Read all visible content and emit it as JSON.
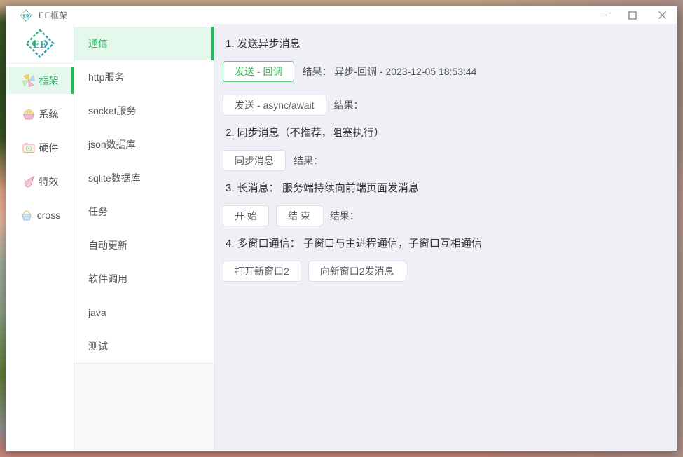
{
  "window": {
    "title": "EE框架",
    "controls": {
      "minimize": "minimize",
      "maximize": "maximize",
      "close": "close"
    }
  },
  "colors": {
    "accent_green": "#21b85f",
    "accent_bar": "#1fbb5b",
    "active_bg": "#e4f8ec",
    "content_bg": "#eef0f5",
    "button_border": "#dadde3",
    "success_border": "#5fc878",
    "success_text": "#3cb45a"
  },
  "sidebar_primary": {
    "logo_text": "EE",
    "items": [
      {
        "label": "框架",
        "icon": "pinwheel-icon",
        "active": true
      },
      {
        "label": "系统",
        "icon": "basket-icon",
        "active": false
      },
      {
        "label": "硬件",
        "icon": "camera-icon",
        "active": false
      },
      {
        "label": "特效",
        "icon": "comet-icon",
        "active": false
      },
      {
        "label": "cross",
        "icon": "bin-icon",
        "active": false
      }
    ]
  },
  "sidebar_secondary": {
    "items": [
      {
        "label": "通信",
        "active": true
      },
      {
        "label": "http服务",
        "active": false
      },
      {
        "label": "socket服务",
        "active": false
      },
      {
        "label": "json数据库",
        "active": false
      },
      {
        "label": "sqlite数据库",
        "active": false
      },
      {
        "label": "任务",
        "active": false
      },
      {
        "label": "自动更新",
        "active": false
      },
      {
        "label": "软件调用",
        "active": false
      },
      {
        "label": "java",
        "active": false
      },
      {
        "label": "测试",
        "active": false
      }
    ]
  },
  "main": {
    "sections": [
      {
        "heading": "1. 发送异步消息",
        "rows": [
          {
            "buttons": [
              {
                "label": "发送 - 回调",
                "variant": "success"
              }
            ],
            "result": "结果： 异步-回调 - 2023-12-05 18:53:44"
          },
          {
            "buttons": [
              {
                "label": "发送 - async/await",
                "variant": "default"
              }
            ],
            "result": "结果："
          }
        ]
      },
      {
        "heading": "2. 同步消息（不推荐，阻塞执行）",
        "rows": [
          {
            "buttons": [
              {
                "label": "同步消息",
                "variant": "default"
              }
            ],
            "result": "结果："
          }
        ]
      },
      {
        "heading": "3. 长消息： 服务端持续向前端页面发消息",
        "rows": [
          {
            "buttons": [
              {
                "label": "开 始",
                "variant": "default"
              },
              {
                "label": "结 束",
                "variant": "default"
              }
            ],
            "result": "结果："
          }
        ]
      },
      {
        "heading": "4. 多窗口通信： 子窗口与主进程通信，子窗口互相通信",
        "rows": [
          {
            "buttons": [
              {
                "label": "打开新窗口2",
                "variant": "default"
              },
              {
                "label": "向新窗口2发消息",
                "variant": "default"
              }
            ],
            "result": ""
          }
        ]
      }
    ]
  }
}
